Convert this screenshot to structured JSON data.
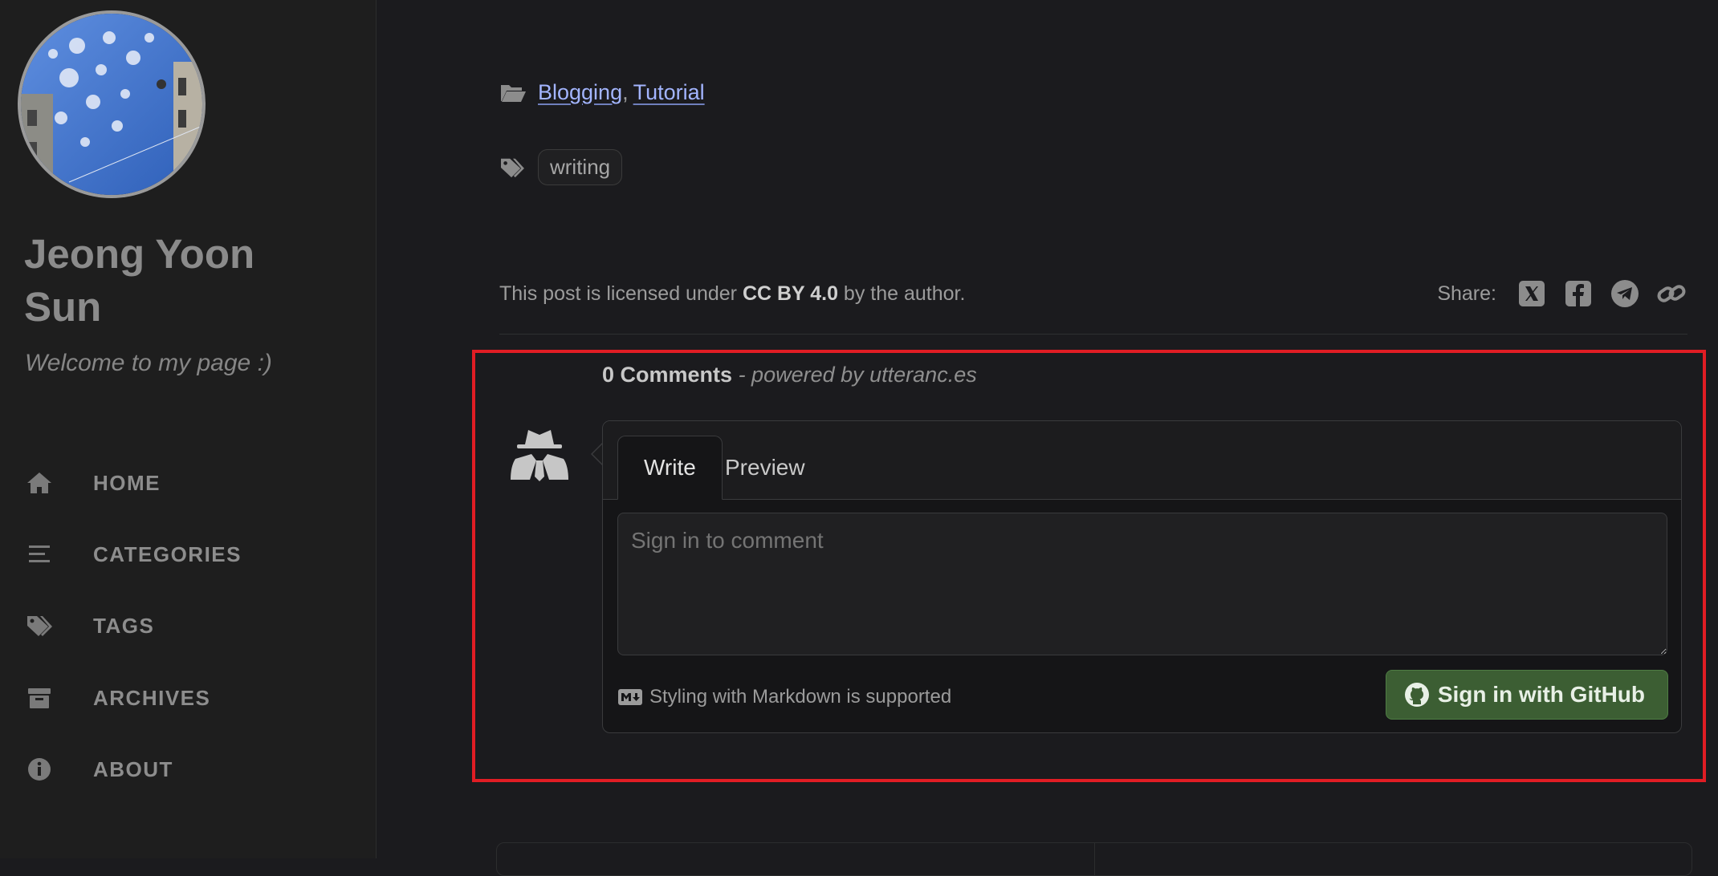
{
  "sidebar": {
    "title": "Jeong Yoon Sun",
    "subtitle": "Welcome to my page :)",
    "nav": [
      {
        "label": "HOME",
        "icon": "home-icon"
      },
      {
        "label": "CATEGORIES",
        "icon": "stream-icon"
      },
      {
        "label": "TAGS",
        "icon": "tags-icon"
      },
      {
        "label": "ARCHIVES",
        "icon": "archive-icon"
      },
      {
        "label": "ABOUT",
        "icon": "info-circle-icon"
      }
    ]
  },
  "post": {
    "categories": [
      "Blogging",
      "Tutorial"
    ],
    "category_separator": ",",
    "tags": [
      "writing"
    ],
    "license": {
      "prefix": "This post is licensed under",
      "name": "CC BY 4.0",
      "suffix": "by the author."
    },
    "share": {
      "label": "Share:",
      "targets": [
        "x-twitter-icon",
        "facebook-icon",
        "telegram-icon",
        "link-icon"
      ]
    }
  },
  "comments": {
    "count_text": "0 Comments",
    "powered_by": "- powered by utteranc.es",
    "tabs": {
      "write": "Write",
      "preview": "Preview"
    },
    "placeholder": "Sign in to comment",
    "markdown_note": "Styling with Markdown is supported",
    "signin_button": "Sign in with GitHub"
  },
  "colors": {
    "highlight_border": "#e11d24",
    "signin_green": "#3c5e33",
    "link_blue": "#a3b5ff"
  }
}
